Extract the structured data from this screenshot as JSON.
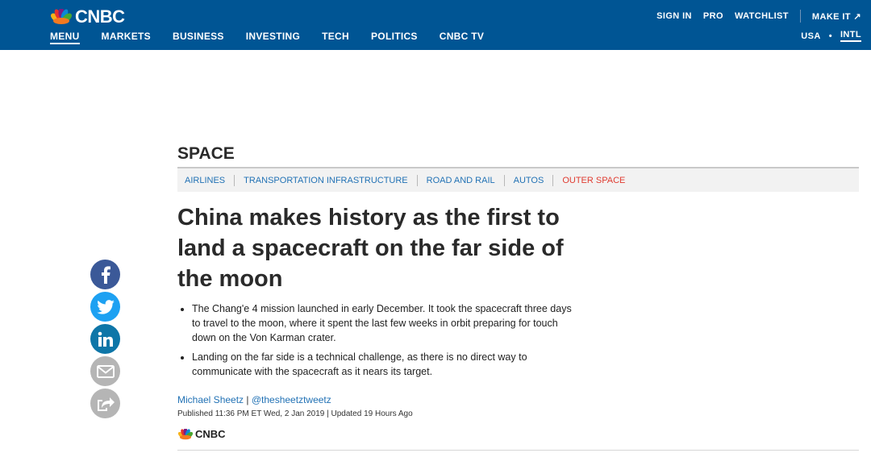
{
  "header": {
    "logo_text": "CNBC",
    "nav": [
      "MENU",
      "MARKETS",
      "BUSINESS",
      "INVESTING",
      "TECH",
      "POLITICS",
      "CNBC TV"
    ],
    "util": [
      "SIGN IN",
      "PRO",
      "WATCHLIST",
      "MAKE IT ↗"
    ],
    "region": {
      "usa": "USA",
      "dot": "•",
      "intl": "INTL"
    }
  },
  "section": {
    "title": "SPACE",
    "subnav": [
      "AIRLINES",
      "TRANSPORTATION INFRASTRUCTURE",
      "ROAD AND RAIL",
      "AUTOS",
      "OUTER SPACE"
    ]
  },
  "article": {
    "headline": "China makes history as the first to land a spacecraft on the far side of the moon",
    "bullets": [
      "The Chang'e 4 mission launched in early December. It took the spacecraft three days to travel to the moon, where it spent the last few weeks in orbit preparing for touch down on the Von Karman crater.",
      "Landing on the far side is a technical challenge, as there is no direct way to communicate with the spacecraft as it nears its target."
    ],
    "author_name": "Michael Sheetz",
    "author_sep": " | ",
    "author_handle": "@thesheetztweetz",
    "published": "Published 11:36 PM ET Wed, 2 Jan 2019 | Updated 19 Hours Ago",
    "source_logo": "CNBC"
  },
  "share": [
    "facebook-icon",
    "twitter-icon",
    "linkedin-icon",
    "email-icon",
    "share-icon"
  ],
  "colors": {
    "header_bg": "#005594",
    "link": "#2272b5",
    "active_sub": "#e03c31"
  }
}
